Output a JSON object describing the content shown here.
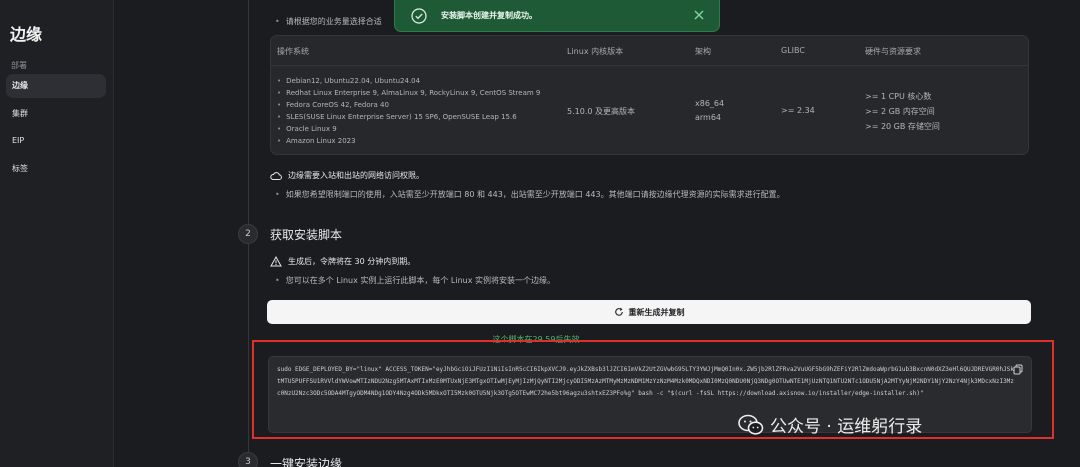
{
  "sidebar": {
    "brand": "边缘",
    "section_label": "部署",
    "items": [
      {
        "label": "边缘",
        "active": true
      },
      {
        "label": "集群",
        "active": false
      },
      {
        "label": "EIP",
        "active": false
      },
      {
        "label": "标签",
        "active": false
      }
    ]
  },
  "toast": {
    "message": "安装脚本创建并复制成功。",
    "icon": "check-circle-icon",
    "color": "#1f5a36"
  },
  "intro_bullet": "请根据您的业务量选择合适",
  "requirements": {
    "headers": [
      "操作系统",
      "Linux 内核版本",
      "架构",
      "GLIBC",
      "硬件与资源要求"
    ],
    "os_list": [
      "Debian12, Ubuntu22.04, Ubuntu24.04",
      "Redhat Linux Enterprise 9, AlmaLinux 9, RockyLinux 9, CentOS Stream 9",
      "Fedora CoreOS 42, Fedora 40",
      "SLES(SUSE Linux Enterprise Server) 15 SP6, OpenSUSE Leap 15.6",
      "Oracle Linux 9",
      "Amazon Linux 2023"
    ],
    "kernel": "5.10.0 及更高版本",
    "arch": [
      "x86_64",
      "arm64"
    ],
    "glibc": ">= 2.34",
    "hardware": [
      ">= 1 CPU 核心数",
      ">= 2 GB 内存空间",
      ">= 20 GB 存储空间"
    ]
  },
  "network_notice": "边缘需要入站和出站的网络访问权限。",
  "network_bullet": "如果您希望限制端口的使用，入站需至少开放端口 80 和 443，出站需至少开放端口 443。其他端口请按边缘代理资源的实际需求进行配置。",
  "steps": [
    {
      "number": "2",
      "title": "获取安装脚本"
    },
    {
      "number": "3",
      "title": "一键安装边缘"
    }
  ],
  "token_notice": "生成后，令牌将在 30 分钟内到期。",
  "script_bullet": "您可以在多个 Linux 实例上运行此脚本，每个 Linux 实例将安装一个边缘。",
  "regenerate_label": "重新生成并复制",
  "expiry_text": "这个脚本在29.59后失效",
  "script_code": "sudo EDGE_DEPLOYED_BY=\"linux\" ACCESS_TOKEN=\"eyJhbGciOiJFUzI1NiIsInR5cCI6IkpXVCJ9.eyJkZXBsb3lJZCI6ImVkZ2UtZGVwbG95LTY3YWJjMmQ0In0x.ZW5jb2RlZFRva2VuUGF5bG9hZEFiY2RlZmdoaWprbG1ub3BxcnN0dXZ3eHl6QUJDREVGR0hJSktMTU5PUFFSU1RVVldYWVowMTIzNDU2Nzg5MTAxMTIxMzE0MTUxNjE3MTgxOTIwMjEyMjIzMjQyNTI2MjcyODI5MzAzMTMyMzMzNDM1MzYzNzM4Mzk0MDQxNDI0MzQ0NDU0NjQ3NDg0OTUwNTE1MjUzNTQ1NTU2NTc1ODU5NjA2MTYyNjM2NDY1NjY2NzY4Njk3MDcxNzI3Mzc0NzU2Nzc3ODc5ODA4MTgyODM4NDg1ODY4Nzg4ODk5MDkxOTI5Mzk0OTU5Njk3OTg5OTEwMC72he5bt96agzu3shtxEZ3PFo%g\" bash -c \"$(curl -fsSL https://download.axisnow.io/installer/edge-installer.sh)\"",
  "watermark": "公众号 · 运维躬行录"
}
